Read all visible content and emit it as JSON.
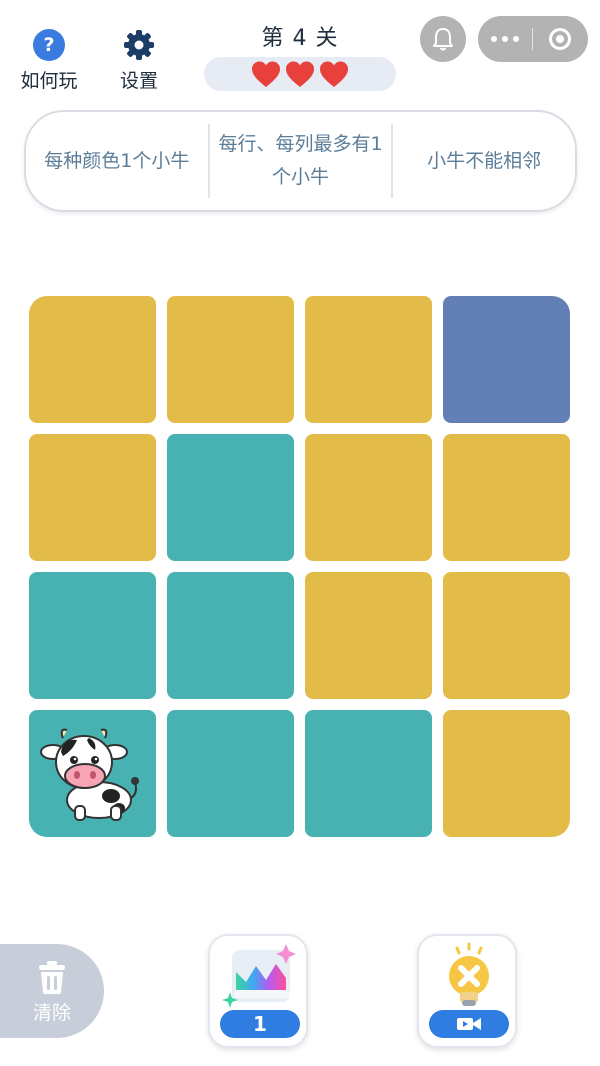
{
  "header": {
    "help_label": "如何玩",
    "help_icon_glyph": "?",
    "settings_label": "设置",
    "level_title": "第 4 关",
    "lives": 3
  },
  "rules": [
    "每种颜色1个小牛",
    "每行、每列最多有1个小牛",
    "小牛不能相邻"
  ],
  "colors": {
    "yellow": "#e3bb48",
    "blue": "#6280b5",
    "teal": "#47b2b1",
    "heart": "#e8413c",
    "accent": "#2f7de0"
  },
  "board": {
    "rows": [
      [
        {
          "color": "yellow",
          "cow": false
        },
        {
          "color": "yellow",
          "cow": false
        },
        {
          "color": "yellow",
          "cow": false
        },
        {
          "color": "blue",
          "cow": false
        }
      ],
      [
        {
          "color": "yellow",
          "cow": false
        },
        {
          "color": "teal",
          "cow": false
        },
        {
          "color": "yellow",
          "cow": false
        },
        {
          "color": "yellow",
          "cow": false
        }
      ],
      [
        {
          "color": "teal",
          "cow": false
        },
        {
          "color": "teal",
          "cow": false
        },
        {
          "color": "yellow",
          "cow": false
        },
        {
          "color": "yellow",
          "cow": false
        }
      ],
      [
        {
          "color": "teal",
          "cow": true
        },
        {
          "color": "teal",
          "cow": false
        },
        {
          "color": "teal",
          "cow": false
        },
        {
          "color": "yellow",
          "cow": false
        }
      ]
    ]
  },
  "bottom": {
    "clear_label": "清除",
    "powerup_count": "1"
  }
}
